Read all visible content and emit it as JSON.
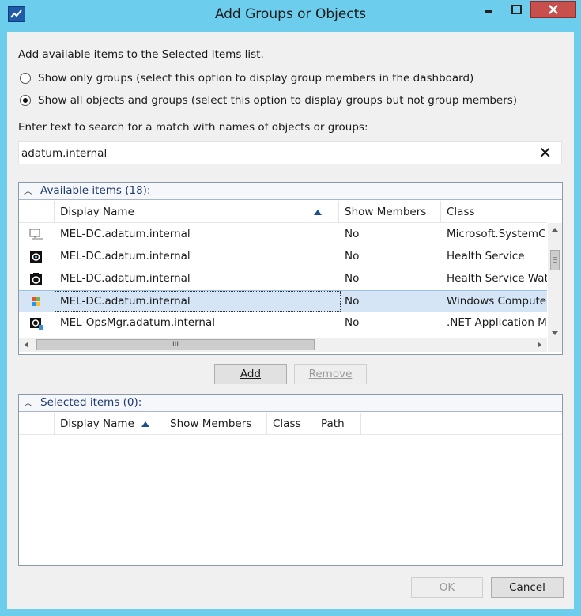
{
  "window": {
    "title": "Add Groups or Objects"
  },
  "intro": "Add available items to the Selected Items list.",
  "options": [
    {
      "label": "Show only groups (select this option to display group members in the dashboard)",
      "selected": false
    },
    {
      "label": "Show all objects and groups (select this option to display groups but not group members)",
      "selected": true
    }
  ],
  "search": {
    "prompt": "Enter text to search for a match with names of objects or groups:",
    "value": "adatum.internal"
  },
  "available": {
    "title": "Available items (18):",
    "columns": [
      "Display Name",
      "Show Members",
      "Class"
    ],
    "rows": [
      {
        "name": "MEL-DC.adatum.internal",
        "show_members": "No",
        "class": "Microsoft.SystemC",
        "icon": "computer-monitor-icon"
      },
      {
        "name": "MEL-DC.adatum.internal",
        "show_members": "No",
        "class": "Health Service",
        "icon": "health-service-icon"
      },
      {
        "name": "MEL-DC.adatum.internal",
        "show_members": "No",
        "class": "Health Service Wat",
        "icon": "health-service-watcher-icon"
      },
      {
        "name": "MEL-DC.adatum.internal",
        "show_members": "No",
        "class": "Windows Compute",
        "icon": "windows-computer-icon",
        "selected": true
      },
      {
        "name": "MEL-OpsMgr.adatum.internal",
        "show_members": "No",
        "class": ".NET Application M",
        "icon": "net-app-icon"
      }
    ],
    "hscroll_grip": "III"
  },
  "buttons": {
    "add": "Add",
    "remove": "Remove",
    "ok": "OK",
    "cancel": "Cancel"
  },
  "selected": {
    "title": "Selected items (0):",
    "columns": [
      "Display Name",
      "Show Members",
      "Class",
      "Path"
    ]
  },
  "colors": {
    "titlebar": "#6ccdec",
    "close": "#c7504d",
    "selection": "#d5e5f6",
    "group_title": "#1e3a6e"
  }
}
